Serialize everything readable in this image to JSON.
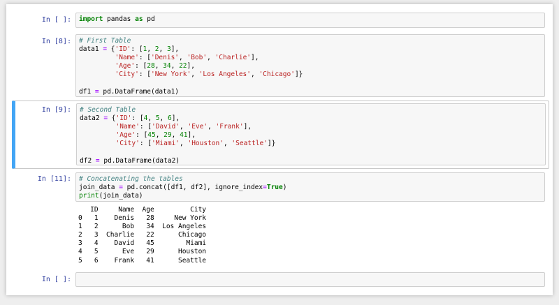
{
  "cells": [
    {
      "prompt": "In [ ]:",
      "lines": [
        [
          {
            "t": "import",
            "c": "kw"
          },
          {
            "t": " pandas ",
            "c": ""
          },
          {
            "t": "as",
            "c": "kw"
          },
          {
            "t": " pd",
            "c": ""
          }
        ]
      ]
    },
    {
      "prompt": "In [8]:",
      "lines": [
        [
          {
            "t": "# First Table",
            "c": "cm"
          }
        ],
        [
          {
            "t": "data1 ",
            "c": ""
          },
          {
            "t": "=",
            "c": "op"
          },
          {
            "t": " {",
            "c": ""
          },
          {
            "t": "'ID'",
            "c": "st"
          },
          {
            "t": ": [",
            "c": ""
          },
          {
            "t": "1",
            "c": "nm"
          },
          {
            "t": ", ",
            "c": ""
          },
          {
            "t": "2",
            "c": "nm"
          },
          {
            "t": ", ",
            "c": ""
          },
          {
            "t": "3",
            "c": "nm"
          },
          {
            "t": "],",
            "c": ""
          }
        ],
        [
          {
            "t": "         ",
            "c": ""
          },
          {
            "t": "'Name'",
            "c": "st"
          },
          {
            "t": ": [",
            "c": ""
          },
          {
            "t": "'Denis'",
            "c": "st"
          },
          {
            "t": ", ",
            "c": ""
          },
          {
            "t": "'Bob'",
            "c": "st"
          },
          {
            "t": ", ",
            "c": ""
          },
          {
            "t": "'Charlie'",
            "c": "st"
          },
          {
            "t": "],",
            "c": ""
          }
        ],
        [
          {
            "t": "         ",
            "c": ""
          },
          {
            "t": "'Age'",
            "c": "st"
          },
          {
            "t": ": [",
            "c": ""
          },
          {
            "t": "28",
            "c": "nm"
          },
          {
            "t": ", ",
            "c": ""
          },
          {
            "t": "34",
            "c": "nm"
          },
          {
            "t": ", ",
            "c": ""
          },
          {
            "t": "22",
            "c": "nm"
          },
          {
            "t": "],",
            "c": ""
          }
        ],
        [
          {
            "t": "         ",
            "c": ""
          },
          {
            "t": "'City'",
            "c": "st"
          },
          {
            "t": ": [",
            "c": ""
          },
          {
            "t": "'New York'",
            "c": "st"
          },
          {
            "t": ", ",
            "c": ""
          },
          {
            "t": "'Los Angeles'",
            "c": "st"
          },
          {
            "t": ", ",
            "c": ""
          },
          {
            "t": "'Chicago'",
            "c": "st"
          },
          {
            "t": "]}",
            "c": ""
          }
        ],
        [
          {
            "t": "",
            "c": ""
          }
        ],
        [
          {
            "t": "df1 ",
            "c": ""
          },
          {
            "t": "=",
            "c": "op"
          },
          {
            "t": " pd.DataFrame(data1)",
            "c": ""
          }
        ]
      ]
    },
    {
      "prompt": "In [9]:",
      "lines": [
        [
          {
            "t": "# Second Table",
            "c": "cm"
          }
        ],
        [
          {
            "t": "data2 ",
            "c": ""
          },
          {
            "t": "=",
            "c": "op"
          },
          {
            "t": " {",
            "c": ""
          },
          {
            "t": "'ID'",
            "c": "st"
          },
          {
            "t": ": [",
            "c": ""
          },
          {
            "t": "4",
            "c": "nm"
          },
          {
            "t": ", ",
            "c": ""
          },
          {
            "t": "5",
            "c": "nm"
          },
          {
            "t": ", ",
            "c": ""
          },
          {
            "t": "6",
            "c": "nm"
          },
          {
            "t": "],",
            "c": ""
          }
        ],
        [
          {
            "t": "         ",
            "c": ""
          },
          {
            "t": "'Name'",
            "c": "st"
          },
          {
            "t": ": [",
            "c": ""
          },
          {
            "t": "'David'",
            "c": "st"
          },
          {
            "t": ", ",
            "c": ""
          },
          {
            "t": "'Eve'",
            "c": "st"
          },
          {
            "t": ", ",
            "c": ""
          },
          {
            "t": "'Frank'",
            "c": "st"
          },
          {
            "t": "],",
            "c": ""
          }
        ],
        [
          {
            "t": "         ",
            "c": ""
          },
          {
            "t": "'Age'",
            "c": "st"
          },
          {
            "t": ": [",
            "c": ""
          },
          {
            "t": "45",
            "c": "nm"
          },
          {
            "t": ", ",
            "c": ""
          },
          {
            "t": "29",
            "c": "nm"
          },
          {
            "t": ", ",
            "c": ""
          },
          {
            "t": "41",
            "c": "nm"
          },
          {
            "t": "],",
            "c": ""
          }
        ],
        [
          {
            "t": "         ",
            "c": ""
          },
          {
            "t": "'City'",
            "c": "st"
          },
          {
            "t": ": [",
            "c": ""
          },
          {
            "t": "'Miami'",
            "c": "st"
          },
          {
            "t": ", ",
            "c": ""
          },
          {
            "t": "'Houston'",
            "c": "st"
          },
          {
            "t": ", ",
            "c": ""
          },
          {
            "t": "'Seattle'",
            "c": "st"
          },
          {
            "t": "]}",
            "c": ""
          }
        ],
        [
          {
            "t": "",
            "c": ""
          }
        ],
        [
          {
            "t": "df2 ",
            "c": ""
          },
          {
            "t": "=",
            "c": "op"
          },
          {
            "t": " pd.DataFrame(data2)",
            "c": ""
          }
        ]
      ]
    },
    {
      "prompt": "In [11]:",
      "lines": [
        [
          {
            "t": "# Concatenating the tables",
            "c": "cm"
          }
        ],
        [
          {
            "t": "join_data ",
            "c": ""
          },
          {
            "t": "=",
            "c": "op"
          },
          {
            "t": " pd.concat([df1, df2], ignore_index",
            "c": ""
          },
          {
            "t": "=",
            "c": "op"
          },
          {
            "t": "True",
            "c": "kw"
          },
          {
            "t": ")",
            "c": ""
          }
        ],
        [
          {
            "t": "print",
            "c": "nm"
          },
          {
            "t": "(join_data)",
            "c": ""
          }
        ]
      ],
      "output": [
        "   ID     Name  Age         City",
        "0   1    Denis   28     New York",
        "1   2      Bob   34  Los Angeles",
        "2   3  Charlie   22      Chicago",
        "3   4    David   45        Miami",
        "4   5      Eve   29      Houston",
        "5   6    Frank   41      Seattle"
      ]
    },
    {
      "prompt": "In [ ]:",
      "lines": [
        [
          {
            "t": "",
            "c": ""
          }
        ]
      ]
    }
  ],
  "theme": {
    "prompt_color": "#303f9f",
    "selected_border": "#42a5f5",
    "input_background": "#f7f7f7"
  }
}
